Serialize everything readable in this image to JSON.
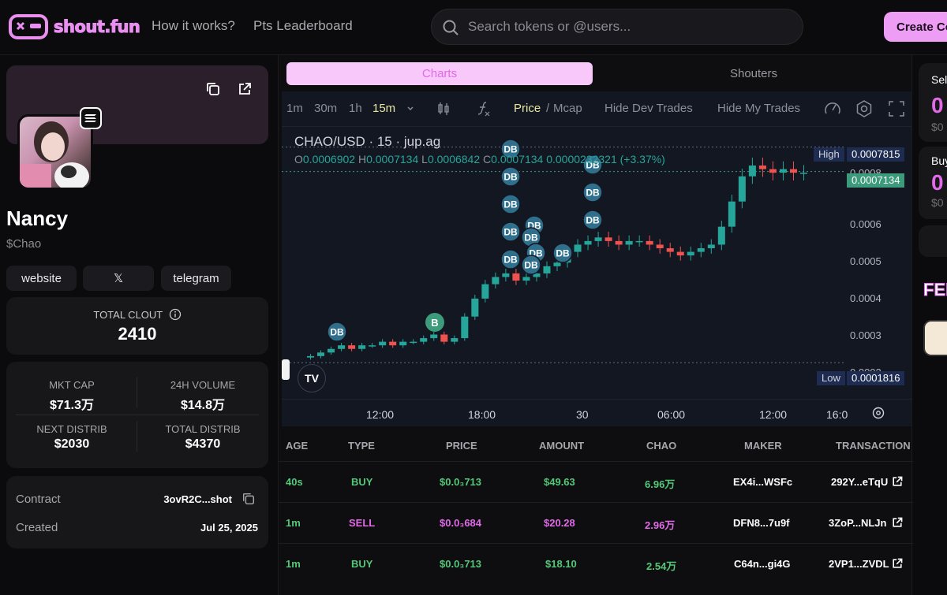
{
  "header": {
    "logo_text": "shout.fun",
    "nav": [
      "How it works?",
      "Pts Leaderboard"
    ],
    "search_placeholder": "Search tokens or @users...",
    "create_label": "Create Co"
  },
  "profile": {
    "name": "Nancy",
    "ticker": "$Chao",
    "socials": [
      "website",
      "𝕏",
      "telegram"
    ]
  },
  "clout": {
    "label": "TOTAL CLOUT",
    "value": "2410"
  },
  "stats": {
    "mkt_cap_label": "MKT CAP",
    "mkt_cap": "$71.3万",
    "volume_label": "24H VOLUME",
    "volume": "$14.8万",
    "next_label": "NEXT DISTRIB",
    "next": "$2030",
    "total_label": "TOTAL DISTRIB",
    "total": "$4370"
  },
  "info": {
    "contract_label": "Contract",
    "contract": "3ovR2C...shot",
    "created_label": "Created",
    "created": "Jul 25, 2025"
  },
  "tabs": [
    "Charts",
    "Shouters"
  ],
  "toolbar": {
    "intervals": [
      "1m",
      "30m",
      "1h",
      "15m"
    ],
    "price": "Price",
    "sep": "/",
    "mcap": "Mcap",
    "hide_dev": "Hide Dev Trades",
    "hide_my": "Hide My Trades"
  },
  "chart_data": {
    "type": "candlestick",
    "title": "CHAO/USD · 15 · jup.ag",
    "ohlc": {
      "O": "0.0006902",
      "H": "0.0007134",
      "L": "0.0006842",
      "C": "0.0007134",
      "change": "0.0000232321 (+3.37%)"
    },
    "y_ticks": [
      "0.0008",
      "0.0006",
      "0.0005",
      "0.0004",
      "0.0003",
      "0.0002"
    ],
    "x_ticks": [
      "12:00",
      "18:00",
      "30",
      "06:00",
      "12:00",
      "16:0"
    ],
    "high_label": "High",
    "high": "0.0007815",
    "low_label": "Low",
    "low": "0.0001816",
    "last": "0.0007134",
    "marker_label": "DB",
    "buy_marker": "B",
    "close_series": [
      0.0002,
      0.00021,
      0.00022,
      0.00023,
      0.00022,
      0.00023,
      0.00023,
      0.00024,
      0.00023,
      0.00024,
      0.00024,
      0.00025,
      0.00026,
      0.00024,
      0.00025,
      0.00031,
      0.00036,
      0.0004,
      0.00042,
      0.00043,
      0.00041,
      0.00042,
      0.00043,
      0.00045,
      0.00046,
      0.00049,
      0.00051,
      0.00052,
      0.00053,
      0.00052,
      0.00051,
      0.00052,
      0.00052,
      0.00051,
      0.0005,
      0.00049,
      0.00048,
      0.00049,
      0.0005,
      0.00051,
      0.00056,
      0.00063,
      0.0007,
      0.00073,
      0.00072,
      0.00071,
      0.00072,
      0.00071,
      0.00071
    ]
  },
  "table": {
    "headers": [
      "AGE",
      "TYPE",
      "PRICE",
      "AMOUNT",
      "CHAO",
      "MAKER",
      "TRANSACTION"
    ],
    "rows": [
      {
        "age": "40s",
        "type": "BUY",
        "price": "$0.0₃713",
        "amount": "$49.63",
        "chao": "6.96万",
        "maker": "EX4i...WSFc",
        "tx": "292Y...eTqU"
      },
      {
        "age": "1m",
        "type": "SELL",
        "price": "$0.0₃684",
        "amount": "$20.28",
        "chao": "2.96万",
        "maker": "DFN8...7u9f",
        "tx": "3ZoP...NLJn"
      },
      {
        "age": "1m",
        "type": "BUY",
        "price": "$0.0₃713",
        "amount": "$18.10",
        "chao": "2.54万",
        "maker": "C64n...gi4G",
        "tx": "2VP1...ZVDL"
      }
    ]
  },
  "right_panel": {
    "sell_label": "Sel",
    "sell_value": "0",
    "sell_sub": "$0",
    "buy_label": "Buy",
    "buy_value": "0",
    "buy_sub": "$0",
    "feed_label": "FEE"
  },
  "colors": {
    "accent": "#ee9df5",
    "buy": "#53c978",
    "sell": "#e06ae8",
    "up": "#26a69a",
    "down": "#ef5350"
  }
}
